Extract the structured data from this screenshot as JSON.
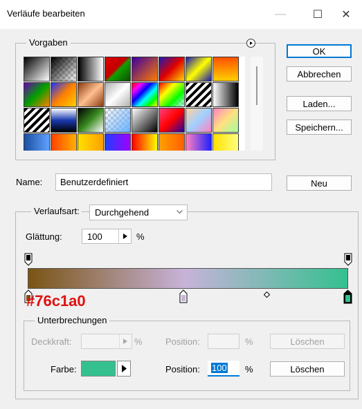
{
  "window": {
    "title": "Verläufe bearbeiten",
    "controls": {
      "minimize": "—",
      "maximize": "☐",
      "close": "✕"
    }
  },
  "presets": {
    "legend": "Vorgaben"
  },
  "buttons": {
    "ok": "OK",
    "cancel": "Abbrechen",
    "load": "Laden...",
    "save": "Speichern...",
    "new": "Neu"
  },
  "name": {
    "label": "Name:",
    "value": "Benutzerdefiniert"
  },
  "gradient": {
    "type_label": "Verlaufsart:",
    "type_value": "Durchgehend",
    "smooth_label": "Glättung:",
    "smooth_value": "100",
    "smooth_unit": "%",
    "overlay_label": "#76c1a0",
    "colors": {
      "left": "#7a5414",
      "mid": "#c7b3d9",
      "right": "#34c08f"
    }
  },
  "stops": {
    "legend": "Unterbrechungen",
    "opacity_label": "Deckkraft:",
    "opacity_unit": "%",
    "opacity_position_label": "Position:",
    "opacity_position_unit": "%",
    "opacity_delete": "Löschen",
    "color_label": "Farbe:",
    "color_value": "#34c08f",
    "color_position_label": "Position:",
    "color_position_value": "100",
    "color_position_unit": "%",
    "color_delete": "Löschen"
  }
}
